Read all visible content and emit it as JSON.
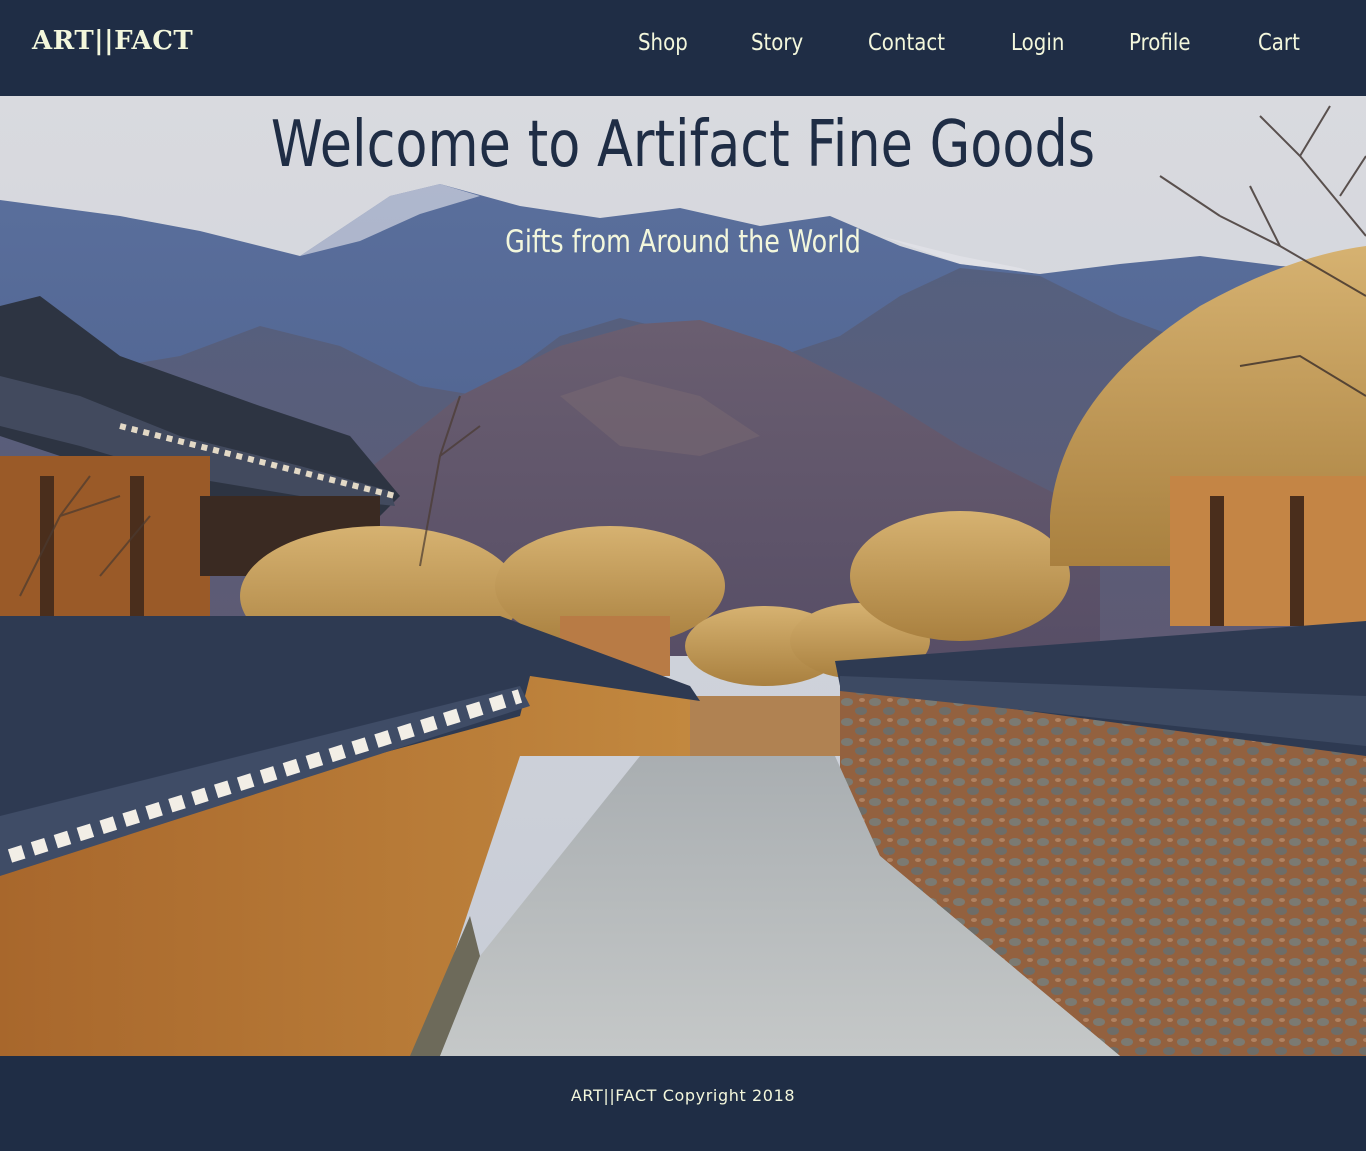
{
  "header": {
    "logo": "ART||FACT",
    "nav": [
      {
        "label": "Shop"
      },
      {
        "label": "Story"
      },
      {
        "label": "Contact"
      },
      {
        "label": "Login"
      },
      {
        "label": "Profile"
      },
      {
        "label": "Cart"
      }
    ]
  },
  "hero": {
    "title": "Welcome to Artifact Fine Goods",
    "subtitle": "Gifts from Around the World"
  },
  "footer": {
    "copyright": "ART||FACT Copyright 2018"
  },
  "colors": {
    "navy": "#1f2d45",
    "cream": "#f3f7dc"
  }
}
